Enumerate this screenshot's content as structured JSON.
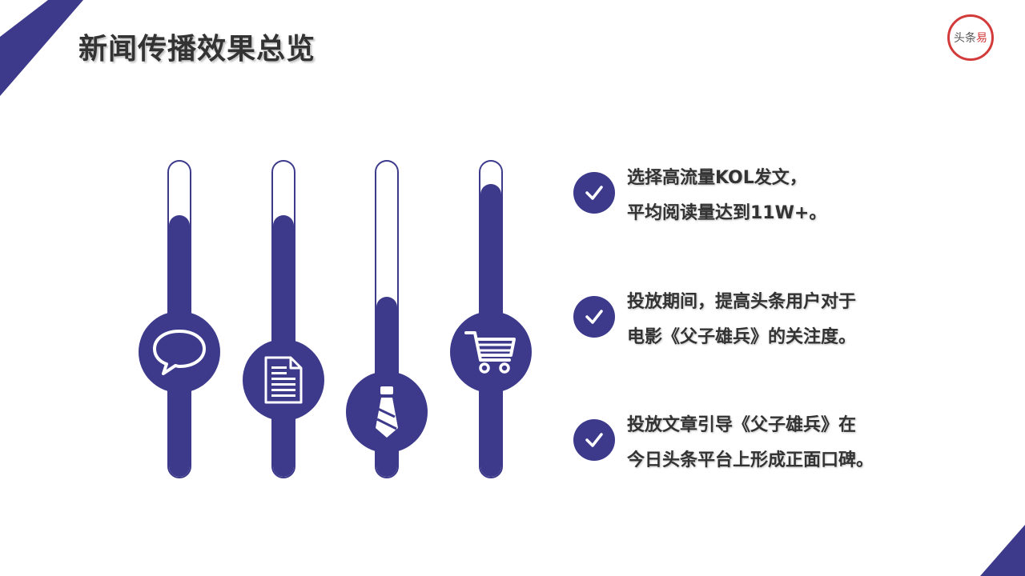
{
  "page": {
    "title": "新闻传播效果总览",
    "accent_color": "#3d3a8c",
    "logo": {
      "text_main": "头条",
      "text_accent": "易",
      "ring_color": "#d33b3b"
    }
  },
  "sliders": [
    {
      "icon": "speech-bubble-icon",
      "level": 0.83
    },
    {
      "icon": "document-icon",
      "level": 0.83
    },
    {
      "icon": "tie-icon",
      "level": 0.57
    },
    {
      "icon": "shopping-cart-icon",
      "level": 0.93
    }
  ],
  "items": [
    {
      "icon": "check-icon",
      "lines": [
        "选择高流量KOL发文，",
        "平均阅读量达到11W+。"
      ]
    },
    {
      "icon": "check-icon",
      "lines": [
        "投放期间，提高头条用户对于",
        "电影《父子雄兵》的关注度。"
      ]
    },
    {
      "icon": "check-icon",
      "lines": [
        "投放文章引导《父子雄兵》在",
        "今日头条平台上形成正面口碑。"
      ]
    }
  ]
}
